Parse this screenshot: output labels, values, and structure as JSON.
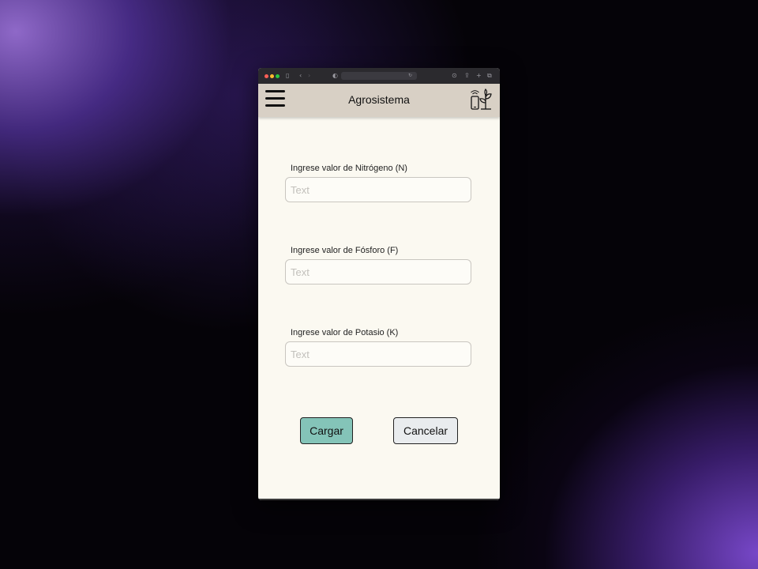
{
  "app": {
    "title": "Agrosistema"
  },
  "form": {
    "fields": [
      {
        "label": "Ingrese valor de Nitrógeno (N)",
        "placeholder": "Text",
        "value": ""
      },
      {
        "label": "Ingrese valor de Fósforo (F)",
        "placeholder": "Text",
        "value": ""
      },
      {
        "label": "Ingrese valor de Potasio (K)",
        "placeholder": "Text",
        "value": ""
      }
    ],
    "submit_label": "Cargar",
    "cancel_label": "Cancelar"
  },
  "colors": {
    "appbar": "#d8d0c5",
    "background": "#fbf9f1",
    "primary_button": "#84c4b8",
    "secondary_button": "#e9ecee"
  },
  "icons": [
    "menu-icon",
    "iot-plant-icon"
  ]
}
